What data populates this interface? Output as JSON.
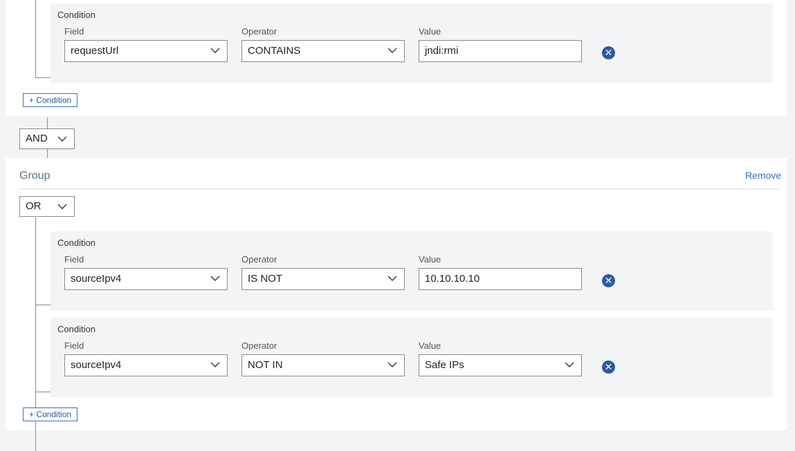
{
  "top_group": {
    "condition": {
      "title": "Condition",
      "field_label": "Field",
      "operator_label": "Operator",
      "value_label": "Value",
      "field_value": "requestUrl",
      "operator_value": "CONTAINS",
      "value_value": "jndi:rmi"
    },
    "add_condition_label": "+ Condition"
  },
  "joiner": {
    "value": "AND"
  },
  "group": {
    "title": "Group",
    "remove_label": "Remove",
    "logic_value": "OR",
    "conditions": [
      {
        "title": "Condition",
        "field_label": "Field",
        "operator_label": "Operator",
        "value_label": "Value",
        "field_value": "sourceIpv4",
        "operator_value": "IS NOT",
        "value_value": "10.10.10.10"
      },
      {
        "title": "Condition",
        "field_label": "Field",
        "operator_label": "Operator",
        "value_label": "Value",
        "field_value": "sourceIpv4",
        "operator_value": "NOT IN",
        "value_value": "Safe IPs"
      }
    ],
    "add_condition_label": "+ Condition"
  },
  "colors": {
    "accent": "#2c5aa0",
    "background": "#f3f4f6",
    "panel": "#ffffff"
  },
  "icons": {
    "chevron": "chevron-down-icon",
    "remove": "close-circle-icon"
  }
}
